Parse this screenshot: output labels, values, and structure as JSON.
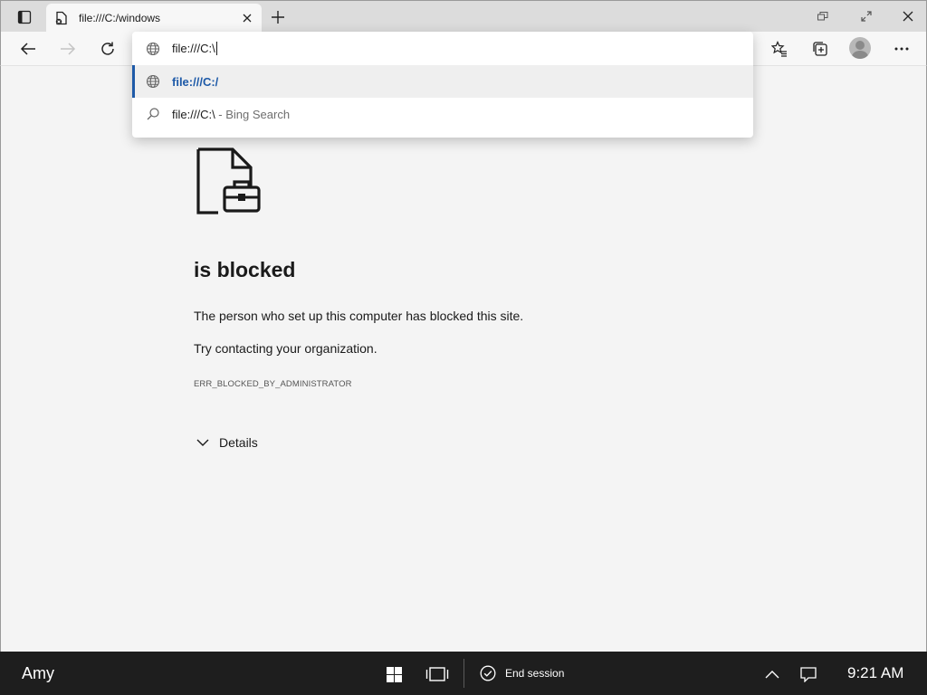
{
  "tab": {
    "title": "file:///C:/windows"
  },
  "omnibox": {
    "input_text": "file:///C:\\",
    "suggestions": [
      {
        "text": "file:///C:/",
        "suffix": ""
      },
      {
        "text": "file:///C:\\",
        "suffix": " - Bing Search"
      }
    ]
  },
  "page": {
    "headline": "is blocked",
    "line1": "The person who set up this computer has blocked this site.",
    "line2": "Try contacting your organization.",
    "error_code": "ERR_BLOCKED_BY_ADMINISTRATOR",
    "details_label": "Details"
  },
  "taskbar": {
    "user": "Amy",
    "end_session_label": "End session",
    "time": "9:21 AM"
  },
  "colors": {
    "accent": "#1e5aa8",
    "taskbar": "#1e1e1e",
    "page_bg": "#f4f4f4"
  }
}
